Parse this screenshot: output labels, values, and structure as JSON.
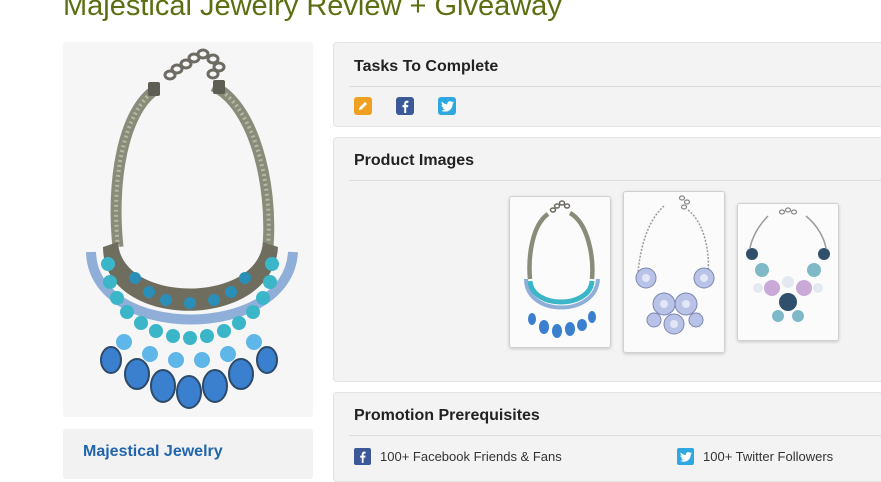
{
  "page": {
    "title": "Majestical Jewelry Review + Giveaway"
  },
  "sidebar": {
    "brand_name": "Majestical Jewelry"
  },
  "tasks": {
    "title": "Tasks To Complete",
    "icons": [
      "pencil-icon",
      "facebook-icon",
      "twitter-icon"
    ]
  },
  "images": {
    "title": "Product Images"
  },
  "prerequisites": {
    "title": "Promotion Prerequisites",
    "items": [
      {
        "icon": "facebook-icon",
        "label": "100+ Facebook Friends & Fans"
      },
      {
        "icon": "twitter-icon",
        "label": "100+ Twitter Followers"
      }
    ]
  },
  "colors": {
    "title_green": "#5b6e12",
    "brand_blue": "#2166ac",
    "facebook": "#3b5998",
    "twitter": "#2fa8e1",
    "pencil": "#f0a020"
  }
}
